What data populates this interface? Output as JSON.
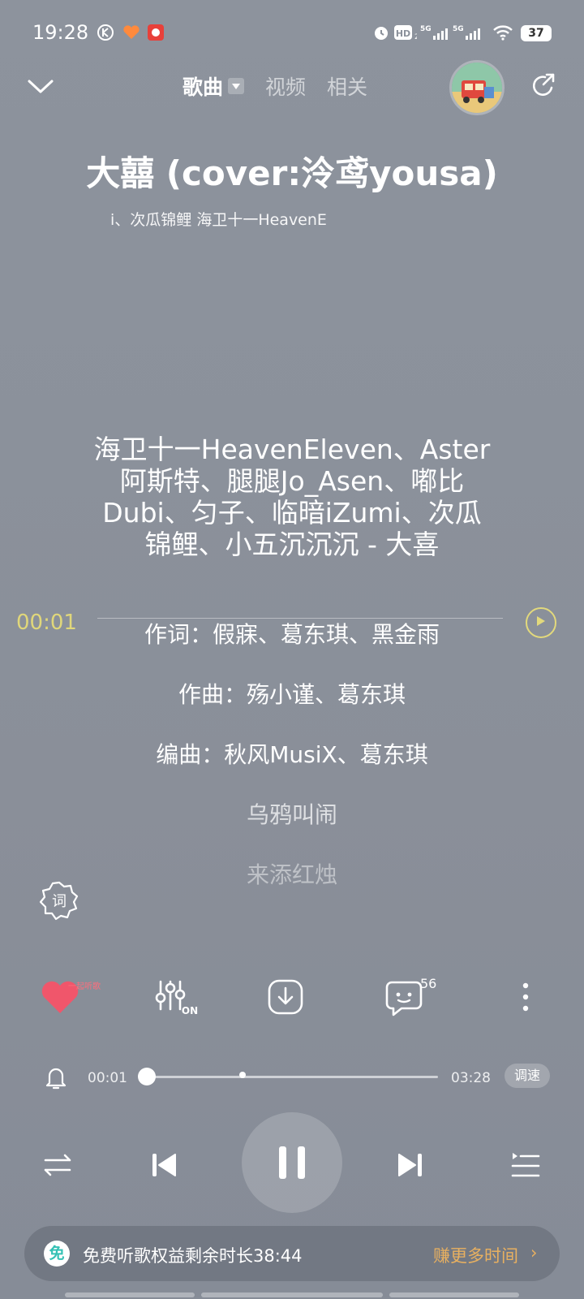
{
  "status_bar": {
    "time": "19:28",
    "battery": "37",
    "network_1": "5G",
    "network_2": "5G",
    "hd_label": "HD"
  },
  "nav": {
    "tabs": [
      "歌曲",
      "视频",
      "相关"
    ]
  },
  "song": {
    "title": "大囍 (cover:泠鸢yousa)",
    "artist_scroll": "i、次瓜锦鲤                               海卫十一HeavenE"
  },
  "lyrics": {
    "header_lines": [
      "海卫十一HeavenEleven、Aster",
      "阿斯特、腿腿Jo_Asen、嘟比",
      "Dubi、匀子、临暗iZumi、次瓜",
      "锦鲤、小五沉沉沉  -  大喜"
    ],
    "current_time": "00:01",
    "lines": [
      "作词：假寐、葛东琪、黑金雨",
      "作曲：殇小谨、葛东琪",
      "编曲：秋风MusiX、葛东琪",
      "乌鸦叫闹",
      "来添红烛"
    ],
    "lyric_toggle": "词"
  },
  "actions": {
    "comment_count": "56",
    "like_tag": "一起听歌",
    "eq_label": "ON"
  },
  "progress": {
    "elapsed": "00:01",
    "total": "03:28",
    "speed_label": "调速",
    "fraction": 0.005
  },
  "banner": {
    "icon": "免",
    "text": "免费听歌权益剩余时长38:44",
    "link": "赚更多时间",
    "arrow": "›"
  },
  "colors": {
    "accent_yellow": "#e0d77a",
    "like_red": "#f0566b",
    "free_orange": "#e8b060"
  }
}
